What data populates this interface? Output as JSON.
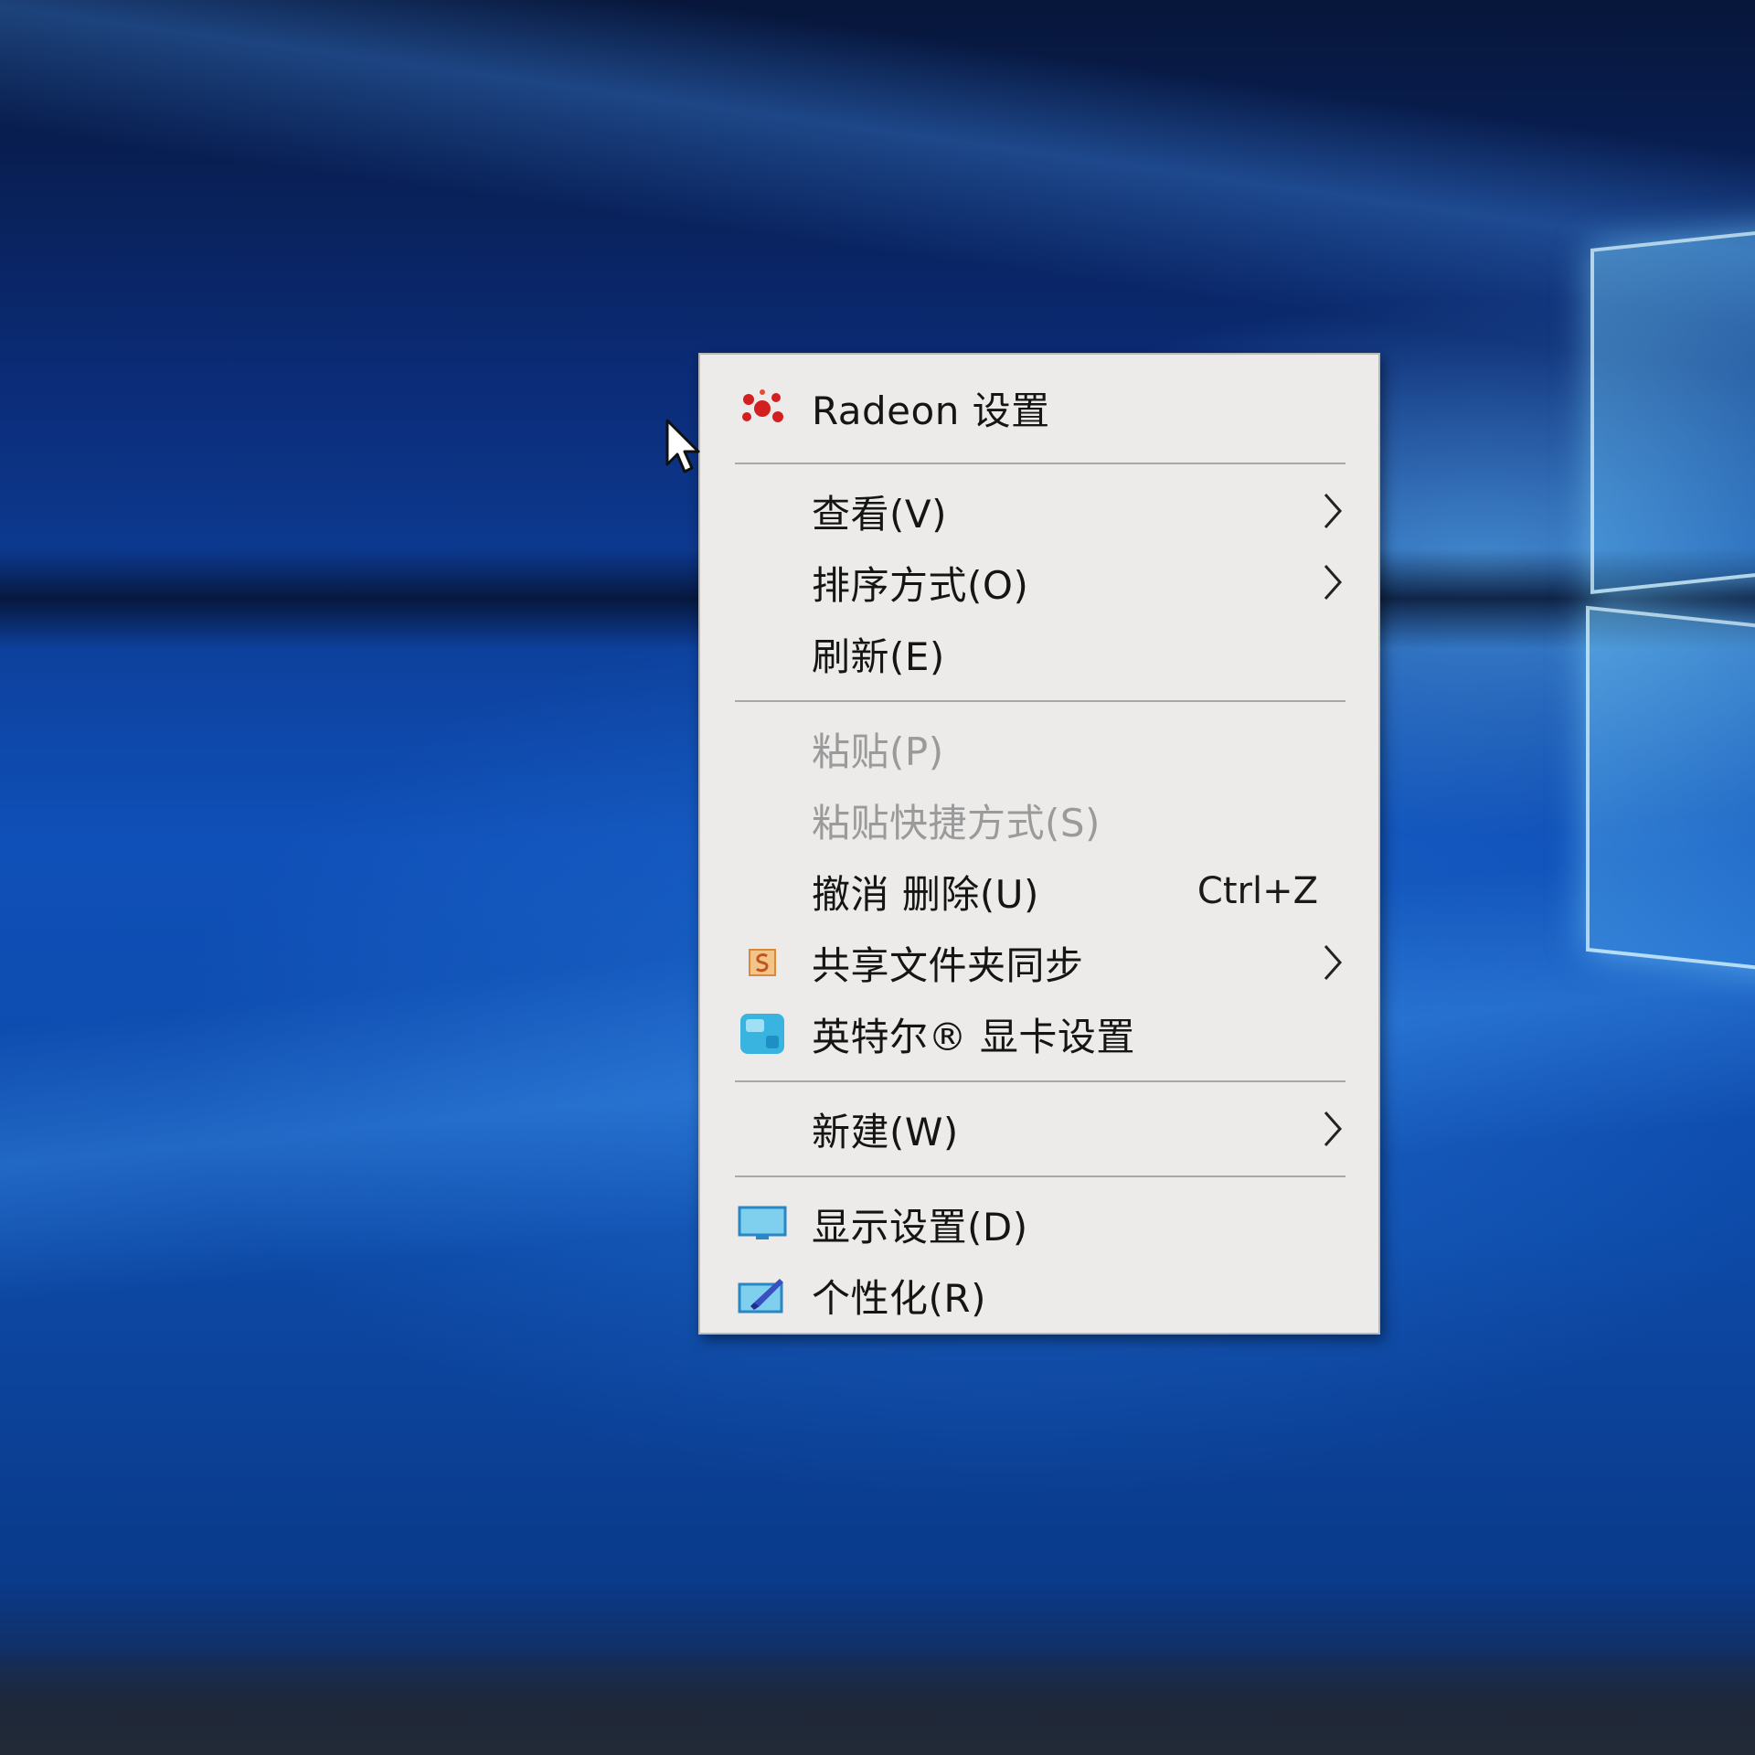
{
  "colors": {
    "menu_background": "#ecebe9",
    "menu_text": "#151515",
    "menu_disabled_text": "#9a9a9a",
    "separator": "#a8a8a8",
    "radeon_red": "#d21f1f",
    "wallpaper_blue": "#0f50b8"
  },
  "context_menu": {
    "items": [
      {
        "label": "Radeon 设置",
        "icon": "radeon-icon"
      },
      {
        "label": "查看(V)",
        "submenu": true
      },
      {
        "label": "排序方式(O)",
        "submenu": true
      },
      {
        "label": "刷新(E)"
      },
      {
        "label": "粘贴(P)",
        "disabled": true
      },
      {
        "label": "粘贴快捷方式(S)",
        "disabled": true
      },
      {
        "label": "撤消 删除(U)",
        "shortcut": "Ctrl+Z"
      },
      {
        "label": "共享文件夹同步",
        "icon": "sync-folder-icon",
        "submenu": true
      },
      {
        "label": "英特尔® 显卡设置",
        "icon": "intel-graphics-icon"
      },
      {
        "label": "新建(W)",
        "submenu": true
      },
      {
        "label": "显示设置(D)",
        "icon": "display-icon"
      },
      {
        "label": "个性化(R)",
        "icon": "personalize-icon"
      }
    ]
  }
}
